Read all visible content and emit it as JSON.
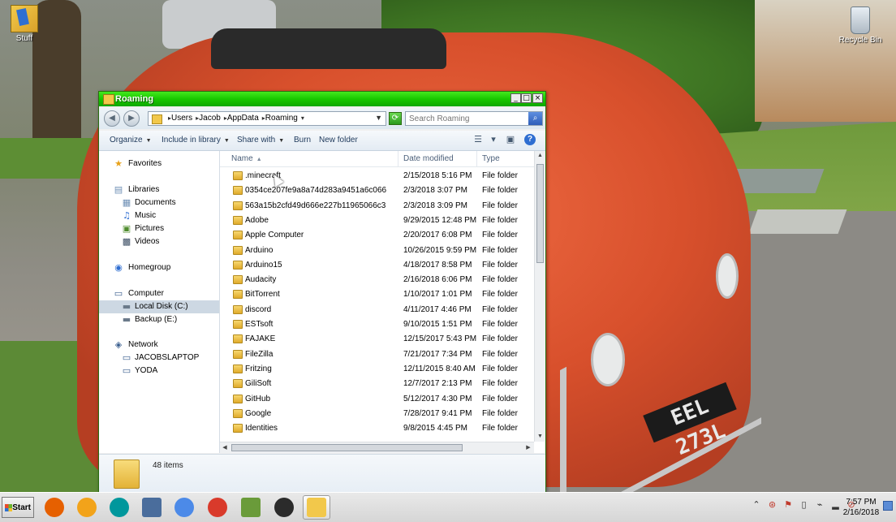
{
  "desktop": {
    "icons": [
      {
        "label": "Stuff"
      },
      {
        "label": "Recycle Bin"
      }
    ],
    "plate_text": "EEL 273L"
  },
  "window": {
    "title": "Roaming",
    "controls": {
      "minimize": "_",
      "maximize": "□",
      "close": "×"
    },
    "address": {
      "crumbs": [
        "Users",
        "Jacob",
        "AppData",
        "Roaming"
      ]
    },
    "search": {
      "placeholder": "Search Roaming"
    },
    "toolbar": {
      "organize": "Organize",
      "include_in_library": "Include in library",
      "share_with": "Share with",
      "burn": "Burn",
      "new_folder": "New folder"
    },
    "nav_pane": {
      "favorites": "Favorites",
      "libraries": "Libraries",
      "documents": "Documents",
      "music": "Music",
      "pictures": "Pictures",
      "videos": "Videos",
      "homegroup": "Homegroup",
      "computer": "Computer",
      "local_disk": "Local Disk (C:)",
      "backup": "Backup (E:)",
      "network": "Network",
      "jacobslaptop": "JACOBSLAPTOP",
      "yoda": "YODA"
    },
    "columns": {
      "name": "Name",
      "date_modified": "Date modified",
      "type": "Type"
    },
    "files": [
      {
        "name": ".minecraft",
        "date": "2/15/2018 5:16 PM",
        "type": "File folder"
      },
      {
        "name": "0354ce207fe9a8a74d283a9451a6c066",
        "date": "2/3/2018 3:07 PM",
        "type": "File folder"
      },
      {
        "name": "563a15b2cfd49d666e227b11965066c3",
        "date": "2/3/2018 3:09 PM",
        "type": "File folder"
      },
      {
        "name": "Adobe",
        "date": "9/29/2015 12:48 PM",
        "type": "File folder"
      },
      {
        "name": "Apple Computer",
        "date": "2/20/2017 6:08 PM",
        "type": "File folder"
      },
      {
        "name": "Arduino",
        "date": "10/26/2015 9:59 PM",
        "type": "File folder"
      },
      {
        "name": "Arduino15",
        "date": "4/18/2017 8:58 PM",
        "type": "File folder"
      },
      {
        "name": "Audacity",
        "date": "2/16/2018 6:06 PM",
        "type": "File folder"
      },
      {
        "name": "BitTorrent",
        "date": "1/10/2017 1:01 PM",
        "type": "File folder"
      },
      {
        "name": "discord",
        "date": "4/11/2017 4:46 PM",
        "type": "File folder"
      },
      {
        "name": "ESTsoft",
        "date": "9/10/2015 1:51 PM",
        "type": "File folder"
      },
      {
        "name": "FAJAKE",
        "date": "12/15/2017 5:43 PM",
        "type": "File folder"
      },
      {
        "name": "FileZilla",
        "date": "7/21/2017 7:34 PM",
        "type": "File folder"
      },
      {
        "name": "Fritzing",
        "date": "12/11/2015 8:40 AM",
        "type": "File folder"
      },
      {
        "name": "GiliSoft",
        "date": "12/7/2017 2:13 PM",
        "type": "File folder"
      },
      {
        "name": "GitHub",
        "date": "5/12/2017 4:30 PM",
        "type": "File folder"
      },
      {
        "name": "Google",
        "date": "7/28/2017 9:41 PM",
        "type": "File folder"
      },
      {
        "name": "Identities",
        "date": "9/8/2015 4:45 PM",
        "type": "File folder"
      }
    ],
    "status": {
      "item_count": "48 items"
    }
  },
  "taskbar": {
    "start_label": "Start",
    "apps": [
      {
        "icon": "firefox-icon",
        "color": "#e66000"
      },
      {
        "icon": "audacity-icon",
        "color": "#f2a31a"
      },
      {
        "icon": "arduino-icon",
        "color": "#00979c"
      },
      {
        "icon": "fritzing-icon",
        "color": "#4a6d9c"
      },
      {
        "icon": "chromium-icon",
        "color": "#4c8ae8"
      },
      {
        "icon": "chrome-icon",
        "color": "#d93a2b"
      },
      {
        "icon": "minecraft-icon",
        "color": "#6a9b3a"
      },
      {
        "icon": "obs-icon",
        "color": "#2b2b2b"
      },
      {
        "icon": "explorer-icon",
        "color": "#f2c84b"
      }
    ],
    "clock": {
      "time": "7:57 PM",
      "date": "2/16/2018"
    }
  }
}
